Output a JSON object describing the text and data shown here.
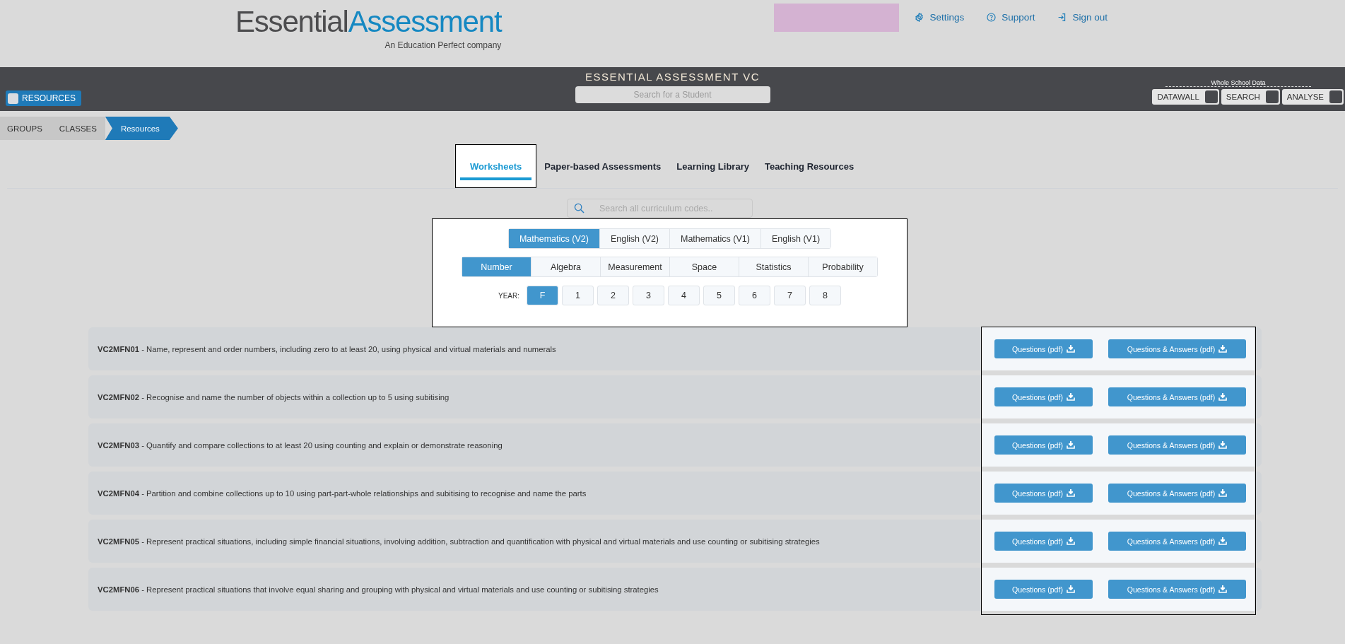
{
  "logo": {
    "first": "Essential",
    "second": "Assessment",
    "tagline": "An Education Perfect company"
  },
  "user_links": [
    {
      "label": "Settings",
      "kind": "gear"
    },
    {
      "label": "Support",
      "kind": "help"
    },
    {
      "label": "Sign out",
      "kind": "exit"
    }
  ],
  "app_bar": {
    "title": "ESSENTIAL ASSESSMENT VC",
    "search_placeholder": "Search for a Student",
    "resources_button": "RESOURCES",
    "whole_school_label": "Whole School Data",
    "toggles": [
      "DATAWALL",
      "SEARCH",
      "ANALYSE"
    ]
  },
  "breadcrumb": [
    {
      "label": "GROUPS",
      "selected": false
    },
    {
      "label": "CLASSES",
      "selected": false
    },
    {
      "label": "Resources",
      "selected": true
    }
  ],
  "tabs": [
    {
      "label": "Worksheets",
      "selected": true
    },
    {
      "label": "Paper-based Assessments",
      "selected": false
    },
    {
      "label": "Learning Library",
      "selected": false
    },
    {
      "label": "Teaching Resources",
      "selected": false
    }
  ],
  "code_search": {
    "placeholder": "Search all curriculum codes.."
  },
  "subjects": [
    {
      "label": "Mathematics (V2)",
      "selected": true
    },
    {
      "label": "English (V2)",
      "selected": false
    },
    {
      "label": "Mathematics (V1)",
      "selected": false
    },
    {
      "label": "English (V1)",
      "selected": false
    }
  ],
  "strands": [
    {
      "label": "Number",
      "selected": true
    },
    {
      "label": "Algebra",
      "selected": false
    },
    {
      "label": "Measurement",
      "selected": false
    },
    {
      "label": "Space",
      "selected": false
    },
    {
      "label": "Statistics",
      "selected": false
    },
    {
      "label": "Probability",
      "selected": false
    }
  ],
  "year_label": "YEAR:",
  "years": [
    {
      "label": "F",
      "selected": true
    },
    {
      "label": "1",
      "selected": false
    },
    {
      "label": "2",
      "selected": false
    },
    {
      "label": "3",
      "selected": false
    },
    {
      "label": "4",
      "selected": false
    },
    {
      "label": "5",
      "selected": false
    },
    {
      "label": "6",
      "selected": false
    },
    {
      "label": "7",
      "selected": false
    },
    {
      "label": "8",
      "selected": false
    }
  ],
  "outcomes": [
    {
      "text": "**VC2MFN01** - Name, represent and order numbers, including zero to at least 20, using physical and virtual materials and numerals",
      "buttons": [
        "Questions (pdf)",
        "Questions & Answers (pdf)"
      ]
    },
    {
      "text": "**VC2MFN02** - Recognise and name the number of objects within a collection up to 5 using subitising",
      "buttons": [
        "Questions (pdf)",
        "Questions & Answers (pdf)"
      ]
    },
    {
      "text": "**VC2MFN03** - Quantify and compare collections to at least 20 using counting and explain or demonstrate reasoning",
      "buttons": [
        "Questions (pdf)",
        "Questions & Answers (pdf)"
      ]
    },
    {
      "text": "**VC2MFN04** - Partition and combine collections up to 10 using part-part-whole relationships and subitising to recognise and name the parts",
      "buttons": [
        "Questions (pdf)",
        "Questions & Answers (pdf)"
      ]
    },
    {
      "text": "**VC2MFN05** - Represent practical situations, including simple financial situations, involving addition, subtraction and quantification with physical and virtual materials and use counting or subitising strategies",
      "buttons": [
        "Questions (pdf)",
        "Questions & Answers (pdf)"
      ]
    },
    {
      "text": "**VC2MFN06** - Represent practical situations that involve equal sharing and grouping with physical and virtual materials and use counting or subitising strategies",
      "buttons": [
        "Questions (pdf)",
        "Questions & Answers (pdf)"
      ]
    }
  ]
}
